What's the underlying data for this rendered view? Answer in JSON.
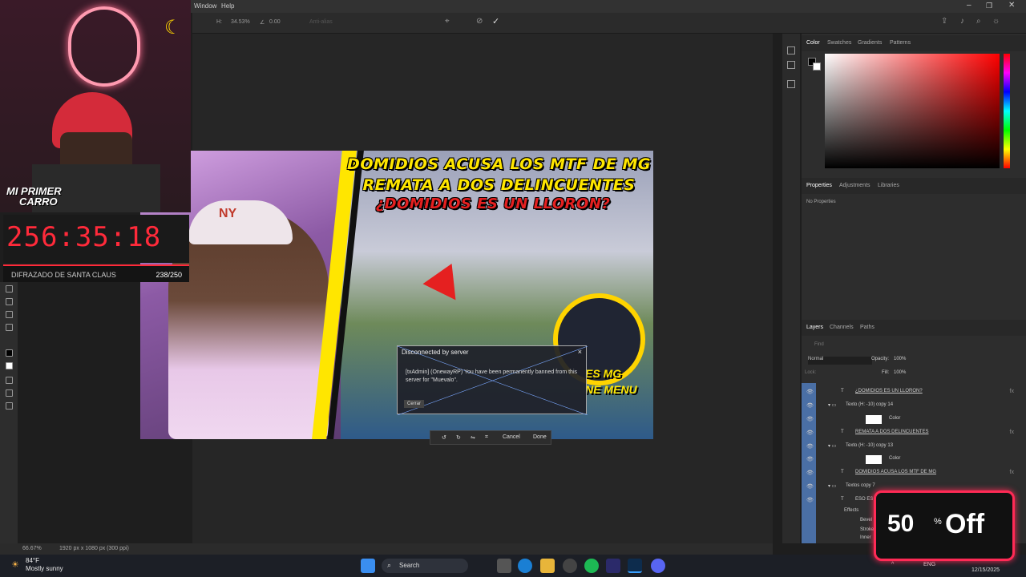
{
  "menu": {
    "window": "Window",
    "help": "Help"
  },
  "options": {
    "width_pct": "34.53%",
    "angle": "0.00",
    "anti_alias": "Anti-alias"
  },
  "thumbnail": {
    "line1": "DOMIDIOS ACUSA LOS MTF DE MG",
    "line2": "REMATA A DOS DELINCUENTES",
    "line3": "¿DOMIDIOS ES UN LLORON?",
    "cap_logo": "NY",
    "overlay1": "ES MG",
    "overlay2": "NE MENU"
  },
  "dialog": {
    "title": "Disconnected by server",
    "close": "×",
    "message": "[txAdmin] (OnewayRP) You have been permanently banned from this server for \"Muevalo\".",
    "button": "Cerrar"
  },
  "transform": {
    "cancel": "Cancel",
    "done": "Done"
  },
  "stream": {
    "logo_line1": "MI PRIMER",
    "logo_line2": "CARRO",
    "timer": "256:35:18",
    "goal_label": "DIFRAZADO DE SANTA CLAUS",
    "goal_count": "238/250"
  },
  "panels": {
    "color_tabs": [
      "Color",
      "Swatches",
      "Gradients",
      "Patterns"
    ],
    "prop_tabs": [
      "Properties",
      "Adjustments",
      "Libraries"
    ],
    "no_props": "No Properties",
    "layer_tabs": [
      "Layers",
      "Channels",
      "Paths"
    ],
    "find": "Find",
    "blend_mode": "Normal",
    "opacity_label": "Opacity:",
    "opacity": "100%",
    "lock_label": "Lock:",
    "fill_label": "Fill:",
    "fill": "100%"
  },
  "layers": [
    {
      "name": "¿DOMIDIOS ES UN LLORON?",
      "kind": "text"
    },
    {
      "name": "Texto (H: -10) copy 14",
      "kind": "group"
    },
    {
      "name": "Color",
      "kind": "fill"
    },
    {
      "name": "REMATA A DOS DELINCUENTES",
      "kind": "text"
    },
    {
      "name": "Texto (H: -10) copy 13",
      "kind": "group"
    },
    {
      "name": "Color",
      "kind": "fill"
    },
    {
      "name": "DOMIDIOS ACUSA LOS MTF DE MG",
      "kind": "text"
    },
    {
      "name": "Textos copy 7",
      "kind": "group"
    },
    {
      "name": "ESO ES",
      "kind": "text"
    },
    {
      "name": "Effects",
      "kind": "effects"
    },
    {
      "name": "Bevel",
      "kind": "effect"
    },
    {
      "name": "Stroke",
      "kind": "effect"
    },
    {
      "name": "Inner",
      "kind": "effect"
    }
  ],
  "status": {
    "zoom": "66.67%",
    "doc": "1920 px x 1080 px (300 ppi)"
  },
  "taskbar": {
    "temp": "84°F",
    "weather": "Mostly sunny",
    "search": "Search",
    "lang": "ENG",
    "date": "12/15/2025"
  },
  "promo": {
    "number": "50",
    "percent": "%",
    "word": "Off"
  },
  "colors": {
    "accent": "#ff2a3a",
    "yellow": "#ffe600",
    "promo_border": "#ff2a55"
  }
}
